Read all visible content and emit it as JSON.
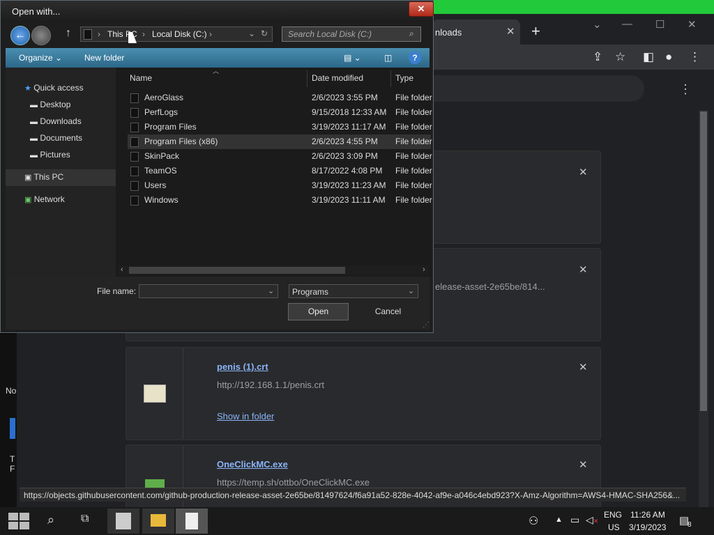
{
  "desktop": {
    "partial_labels": [
      "No",
      "T",
      "F"
    ]
  },
  "browser": {
    "tab_label": "nloads",
    "tab_close": "✕",
    "new_tab": "+",
    "window_controls": [
      "⌄",
      "—",
      "☐",
      "✕"
    ],
    "toolbar_icons": [
      "share-icon",
      "star-icon",
      "sidepanel-icon",
      "profile-icon",
      "menu-icon"
    ],
    "menu_dots": "⋮",
    "cards": [
      {
        "partial_text": "",
        "close": "✕"
      },
      {
        "partial_text": "elease-asset-2e65be/814...",
        "close": "✕"
      },
      {
        "filename": "penis (1).crt",
        "url": "http://192.168.1.1/penis.crt",
        "action": "Show in folder",
        "close": "✕"
      },
      {
        "filename": "OneClickMC.exe",
        "url": "https://temp.sh/ottbo/OneClickMC.exe",
        "close": "✕"
      }
    ],
    "status_url": "https://objects.githubusercontent.com/github-production-release-asset-2e65be/81497624/f6a91a52-828e-4042-af9e-a046c4ebd923?X-Amz-Algorithm=AWS4-HMAC-SHA256&..."
  },
  "dialog": {
    "title": "Open with...",
    "close": "✕",
    "breadcrumb": [
      "This PC",
      "Local Disk (C:)"
    ],
    "search_placeholder": "Search Local Disk (C:)",
    "toolbar": {
      "organize": "Organize",
      "new_folder": "New folder",
      "help": "?"
    },
    "nav": {
      "quick_access": "Quick access",
      "items": [
        "Desktop",
        "Downloads",
        "Documents",
        "Pictures"
      ],
      "this_pc": "This PC",
      "network": "Network"
    },
    "columns": {
      "name": "Name",
      "date": "Date modified",
      "type": "Type"
    },
    "files": [
      {
        "name": "AeroGlass",
        "date": "2/6/2023 3:55 PM",
        "type": "File folder"
      },
      {
        "name": "PerfLogs",
        "date": "9/15/2018 12:33 AM",
        "type": "File folder"
      },
      {
        "name": "Program Files",
        "date": "3/19/2023 11:17 AM",
        "type": "File folder"
      },
      {
        "name": "Program Files (x86)",
        "date": "2/6/2023 4:55 PM",
        "type": "File folder",
        "selected": true
      },
      {
        "name": "SkinPack",
        "date": "2/6/2023 3:09 PM",
        "type": "File folder"
      },
      {
        "name": "TeamOS",
        "date": "8/17/2022 4:08 PM",
        "type": "File folder"
      },
      {
        "name": "Users",
        "date": "3/19/2023 11:23 AM",
        "type": "File folder"
      },
      {
        "name": "Windows",
        "date": "3/19/2023 11:11 AM",
        "type": "File folder"
      }
    ],
    "file_name_label": "File name:",
    "file_name_value": "",
    "file_type": "Programs",
    "open_label": "Open",
    "cancel_label": "Cancel"
  },
  "taskbar": {
    "lang": "ENG",
    "region": "US",
    "time": "11:26 AM",
    "date": "3/19/2023",
    "notification_count": "8"
  }
}
